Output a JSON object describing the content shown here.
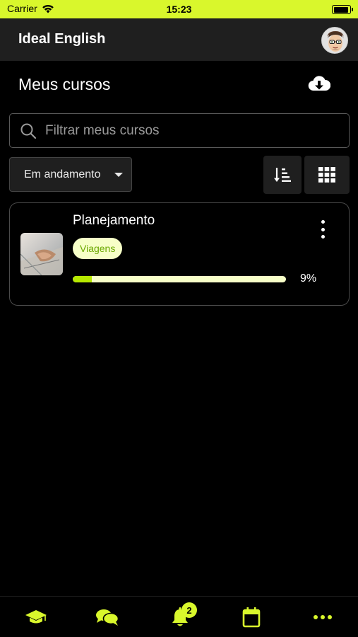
{
  "status_bar": {
    "carrier": "Carrier",
    "time": "15:23",
    "battery_level": 0.95
  },
  "header": {
    "title": "Ideal English",
    "avatar_icon": "user-avatar-icon"
  },
  "page": {
    "title": "Meus cursos",
    "download_icon": "cloud-download-icon"
  },
  "search": {
    "placeholder": "Filtrar meus cursos",
    "value": ""
  },
  "filter": {
    "selected": "Em andamento"
  },
  "toolbar": {
    "sort_icon": "sort-descending-icon",
    "grid_icon": "grid-view-icon"
  },
  "courses": [
    {
      "title": "Planejamento",
      "tag": "Viagens",
      "progress": 9,
      "progress_label": "9%"
    }
  ],
  "tabs": [
    {
      "name": "courses",
      "icon": "graduation-cap-icon"
    },
    {
      "name": "messages",
      "icon": "chat-bubbles-icon"
    },
    {
      "name": "notifications",
      "icon": "bell-icon",
      "badge": "2"
    },
    {
      "name": "calendar",
      "icon": "calendar-icon"
    },
    {
      "name": "more",
      "icon": "more-dots-icon"
    }
  ],
  "colors": {
    "accent": "#d9f72c",
    "tag_bg": "#f7ffc8",
    "tag_text": "#6aa800",
    "progress_fill": "#b6e800",
    "header_bg": "#1f1f1f"
  }
}
